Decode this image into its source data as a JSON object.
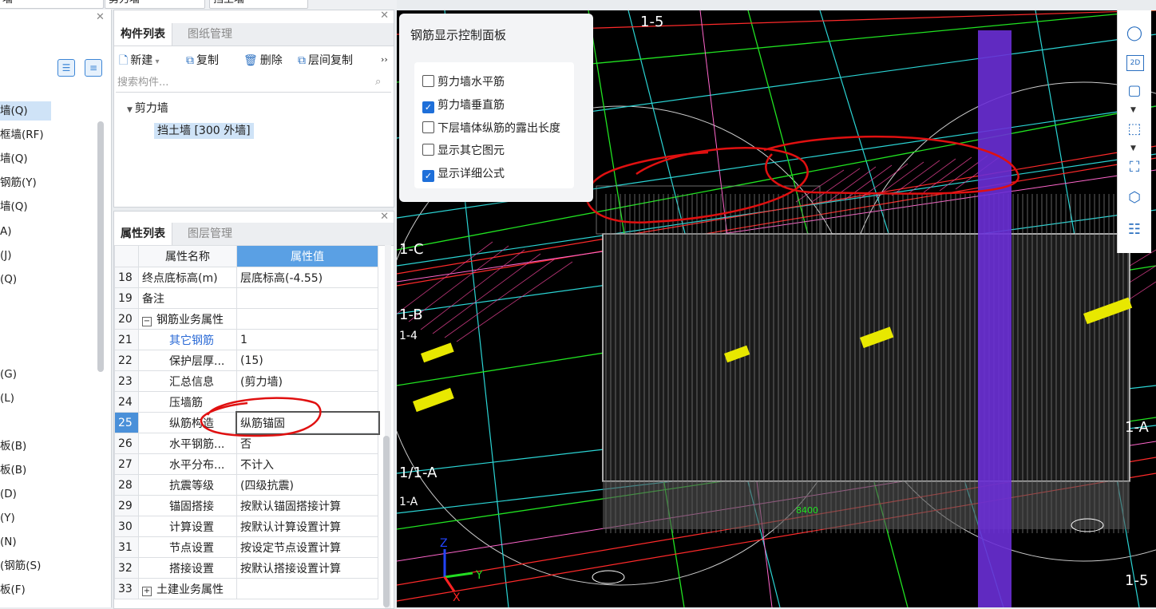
{
  "top_fields": [
    "墙",
    "剪力墙",
    "挡土墙"
  ],
  "left_panel": {
    "items": [
      "墙(Q)",
      "框墙(RF)",
      "墙(Q)",
      "钢筋(Y)",
      "墙(Q)",
      "A)",
      "(J)",
      "(Q)",
      "(G)",
      "(L)",
      "板(B)",
      "板(B)",
      "(D)",
      "(Y)",
      "(N)",
      "(钢筋(S)",
      "板(F)"
    ]
  },
  "component_panel": {
    "tabs": [
      "构件列表",
      "图纸管理"
    ],
    "toolbar": {
      "new": "新建",
      "copy": "复制",
      "delete": "删除",
      "floor_copy": "层间复制",
      "more": "››"
    },
    "search_placeholder": "搜索构件...",
    "tree_group": "剪力墙",
    "tree_selected": "挡土墙 [300 外墙]"
  },
  "property_panel": {
    "tabs": [
      "属性列表",
      "图层管理"
    ],
    "headers": [
      "属性名称",
      "属性值"
    ],
    "rows": [
      {
        "n": "18",
        "name": "终点底标高(m)",
        "value": "层底标高(-4.55)"
      },
      {
        "n": "19",
        "name": "备注",
        "value": ""
      },
      {
        "n": "20",
        "name": "钢筋业务属性",
        "value": "",
        "expander": "−"
      },
      {
        "n": "21",
        "name": "其它钢筋",
        "value": "1"
      },
      {
        "n": "22",
        "name": "保护层厚...",
        "value": "(15)"
      },
      {
        "n": "23",
        "name": "汇总信息",
        "value": "(剪力墙)"
      },
      {
        "n": "24",
        "name": "压墙筋",
        "value": ""
      },
      {
        "n": "25",
        "name": "纵筋构造",
        "value": "纵筋锚固"
      },
      {
        "n": "26",
        "name": "水平钢筋...",
        "value": "否"
      },
      {
        "n": "27",
        "name": "水平分布...",
        "value": "不计入"
      },
      {
        "n": "28",
        "name": "抗震等级",
        "value": "(四级抗震)"
      },
      {
        "n": "29",
        "name": "锚固搭接",
        "value": "按默认锚固搭接计算"
      },
      {
        "n": "30",
        "name": "计算设置",
        "value": "按默认计算设置计算"
      },
      {
        "n": "31",
        "name": "节点设置",
        "value": "按设定节点设置计算"
      },
      {
        "n": "32",
        "name": "搭接设置",
        "value": "按默认搭接设置计算"
      },
      {
        "n": "33",
        "name": "土建业务属性",
        "value": "",
        "expander": "+"
      }
    ]
  },
  "control_panel": {
    "title": "钢筋显示控制面板",
    "options": [
      {
        "label": "剪力墙水平筋",
        "checked": false
      },
      {
        "label": "剪力墙垂直筋",
        "checked": true
      },
      {
        "label": "下层墙体纵筋的露出长度",
        "checked": false
      },
      {
        "label": "显示其它图元",
        "checked": false
      },
      {
        "label": "显示详细公式",
        "checked": true
      }
    ]
  },
  "viewport": {
    "axis_labels": [
      "1-5",
      "1-C",
      "1-B",
      "1-4",
      "1/1-A",
      "1-A",
      "1-A",
      "1-5"
    ],
    "dimension_label": "8400",
    "axis_z": "Z",
    "axis_y": "Y",
    "axis_x": "X"
  },
  "right_toolbar": {
    "label_2d": "2D"
  },
  "colors": {
    "accent": "#4a90d9",
    "viewport_bg": "#000000",
    "annotation": "#e01010"
  }
}
